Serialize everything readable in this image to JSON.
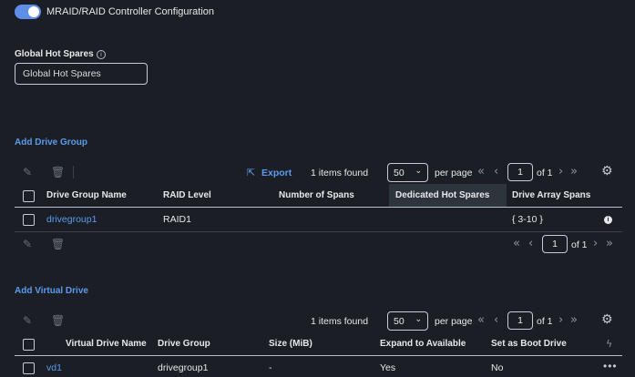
{
  "header": {
    "title": "MRAID/RAID Controller Configuration",
    "toggle_on": true
  },
  "global_hot_spares": {
    "label": "Global Hot Spares",
    "input_value": "Global Hot Spares"
  },
  "drive_group": {
    "add_link": "Add Drive Group",
    "toolbar": {
      "export_label": "Export",
      "items_found": "1 items found",
      "per_page_value": "50",
      "per_page_label": "per page",
      "page": "1",
      "of_pages": "of 1"
    },
    "columns": [
      "Drive Group Name",
      "RAID Level",
      "Number of Spans",
      "Dedicated Hot Spares",
      "Drive Array Spans"
    ],
    "rows": [
      {
        "name": "drivegroup1",
        "raid_level": "RAID1",
        "spans": "",
        "hot_spares": "",
        "array_spans": "{ 3-10 }"
      }
    ],
    "footer": {
      "page": "1",
      "of_pages": "of 1"
    }
  },
  "virtual_drive": {
    "add_link": "Add Virtual Drive",
    "toolbar": {
      "items_found": "1 items found",
      "per_page_value": "50",
      "per_page_label": "per page",
      "page": "1",
      "of_pages": "of 1"
    },
    "columns": [
      "Virtual Drive Name",
      "Drive Group",
      "Size (MiB)",
      "Expand to Available",
      "Set as Boot Drive"
    ],
    "rows": [
      {
        "name": "vd1",
        "drive_group": "drivegroup1",
        "size": "-",
        "expand": "Yes",
        "boot": "No"
      }
    ]
  }
}
